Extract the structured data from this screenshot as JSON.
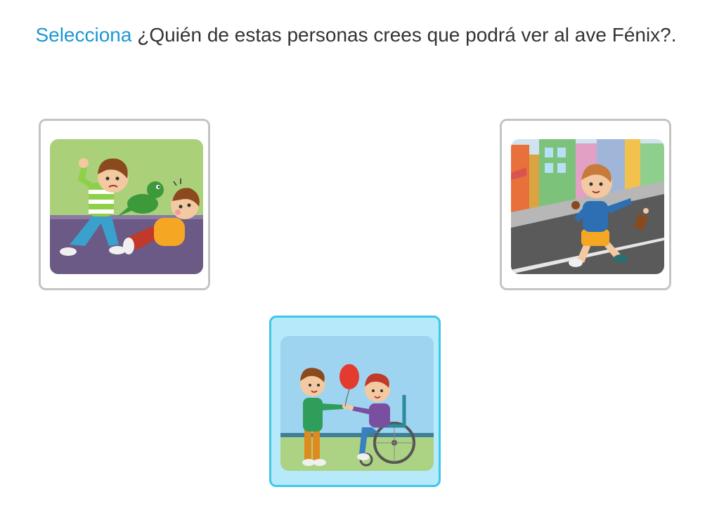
{
  "question": {
    "instruction": "Selecciona",
    "text": " ¿Quién de estas personas crees que podrá ver al ave Fénix?."
  },
  "options": [
    {
      "id": "fight",
      "scene": "boy-hitting-boy-with-toy-dinosaur",
      "selected": false
    },
    {
      "id": "street",
      "scene": "boy-littering-on-street",
      "selected": false
    },
    {
      "id": "help",
      "scene": "boy-giving-balloon-to-boy-in-wheelchair",
      "selected": true
    }
  ],
  "colors": {
    "instruction": "#1a97d3",
    "text": "#333333",
    "card_border": "#c4c4c4",
    "selected_border": "#3cc8ea",
    "selected_background": "#b6eafb"
  }
}
